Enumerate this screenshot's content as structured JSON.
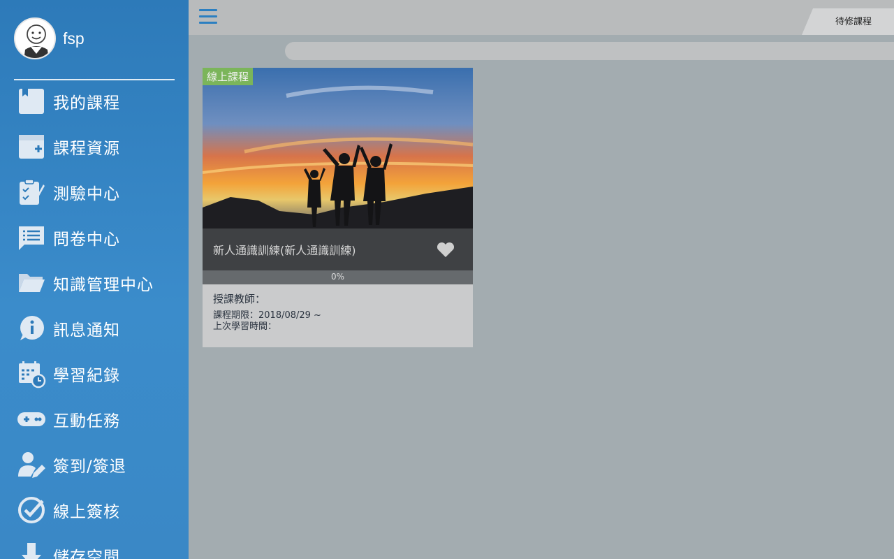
{
  "user": {
    "name": "fsp"
  },
  "sidebar": {
    "items": [
      {
        "label": "我的課程",
        "icon": "book-icon"
      },
      {
        "label": "課程資源",
        "icon": "folder-add-icon"
      },
      {
        "label": "測驗中心",
        "icon": "quiz-clipboard-icon"
      },
      {
        "label": "問卷中心",
        "icon": "survey-chat-icon"
      },
      {
        "label": "知識管理中心",
        "icon": "folder-open-icon"
      },
      {
        "label": "訊息通知",
        "icon": "info-bubble-icon"
      },
      {
        "label": "學習紀錄",
        "icon": "calendar-clock-icon"
      },
      {
        "label": "互動任務",
        "icon": "gamepad-icon"
      },
      {
        "label": "簽到/簽退",
        "icon": "user-edit-icon"
      },
      {
        "label": "線上簽核",
        "icon": "check-circle-icon"
      },
      {
        "label": "儲存空間",
        "icon": "download-icon"
      }
    ]
  },
  "header": {
    "tab_label": "待修課程"
  },
  "course": {
    "badge": "線上課程",
    "title": "新人通識訓練(新人通識訓練)",
    "progress_text": "0%",
    "progress": 0,
    "teacher": "授課教師：",
    "period": "課程期限：2018/08/29 ~",
    "last_study": "上次學習時間："
  },
  "colors": {
    "sidebar": "#3080c0",
    "accent": "#2b7fc1",
    "badge": "#7bb55a"
  }
}
